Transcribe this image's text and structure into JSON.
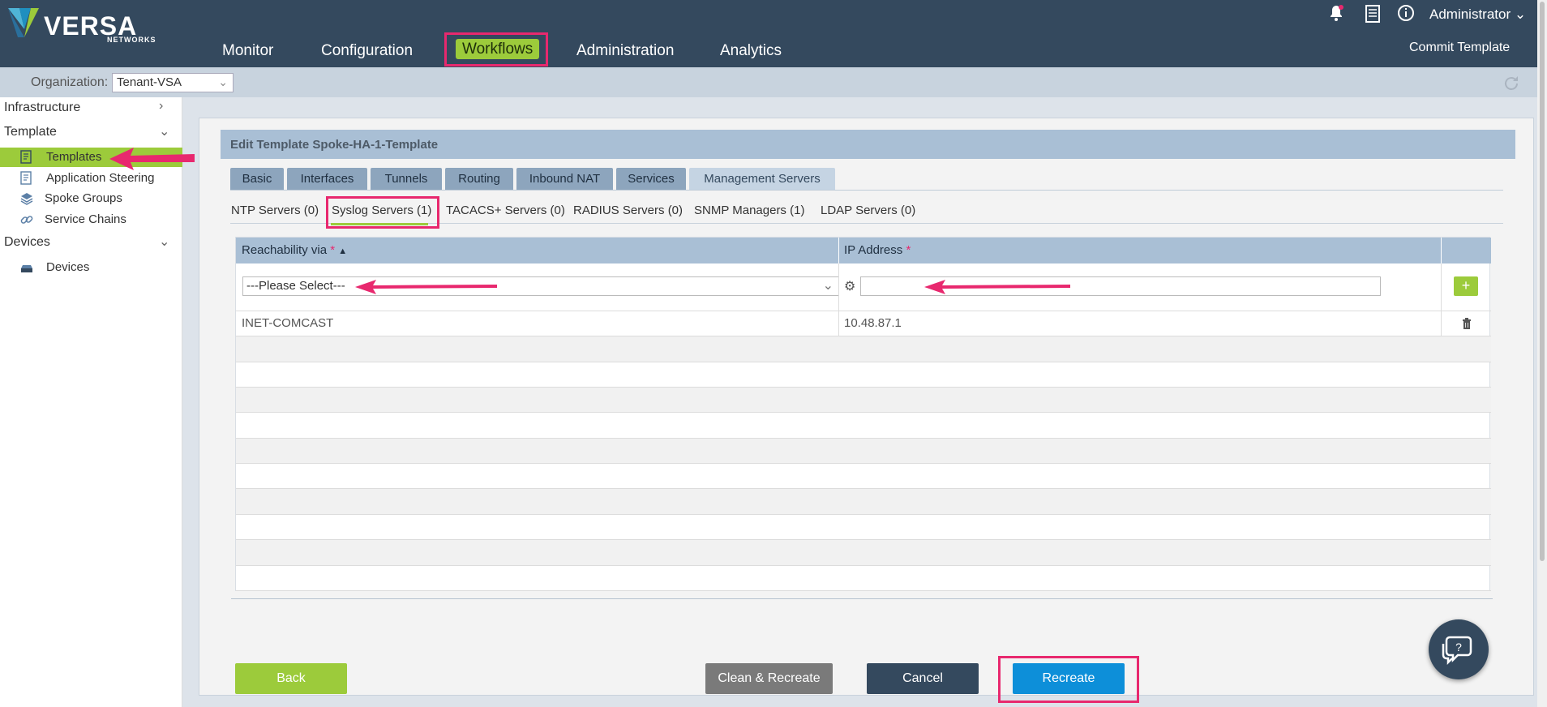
{
  "brand": {
    "name": "VERSA",
    "sub": "NETWORKS"
  },
  "nav": {
    "items": [
      "Monitor",
      "Configuration",
      "Workflows",
      "Administration",
      "Analytics"
    ],
    "active": "Workflows",
    "user": "Administrator",
    "commit": "Commit Template"
  },
  "org": {
    "label": "Organization:",
    "value": "Tenant-VSA"
  },
  "sidebar": {
    "infrastructure": "Infrastructure",
    "template": "Template",
    "templates": "Templates",
    "app_steering": "Application Steering",
    "spoke_groups": "Spoke Groups",
    "service_chains": "Service Chains",
    "devices_section": "Devices",
    "devices": "Devices"
  },
  "panel": {
    "title": "Edit Template Spoke-HA-1-Template"
  },
  "tabs": [
    "Basic",
    "Interfaces",
    "Tunnels",
    "Routing",
    "Inbound NAT",
    "Services",
    "Management Servers"
  ],
  "subtabs": [
    "NTP Servers (0)",
    "Syslog Servers (1)",
    "TACACS+ Servers (0)",
    "RADIUS Servers (0)",
    "SNMP Managers (1)",
    "LDAP Servers (0)"
  ],
  "grid": {
    "col_reach": "Reachability via",
    "col_ip": "IP Address",
    "required_mark": "*",
    "select_placeholder": "---Please Select---",
    "rows": [
      {
        "reachability": "INET-COMCAST",
        "ip": "10.48.87.1"
      }
    ]
  },
  "buttons": {
    "back": "Back",
    "clean": "Clean & Recreate",
    "cancel": "Cancel",
    "recreate": "Recreate"
  },
  "colors": {
    "accent_green": "#9ccb3b",
    "nav_bg": "#34495e",
    "highlight": "#e8286e",
    "primary_blue": "#0d8fd9"
  }
}
